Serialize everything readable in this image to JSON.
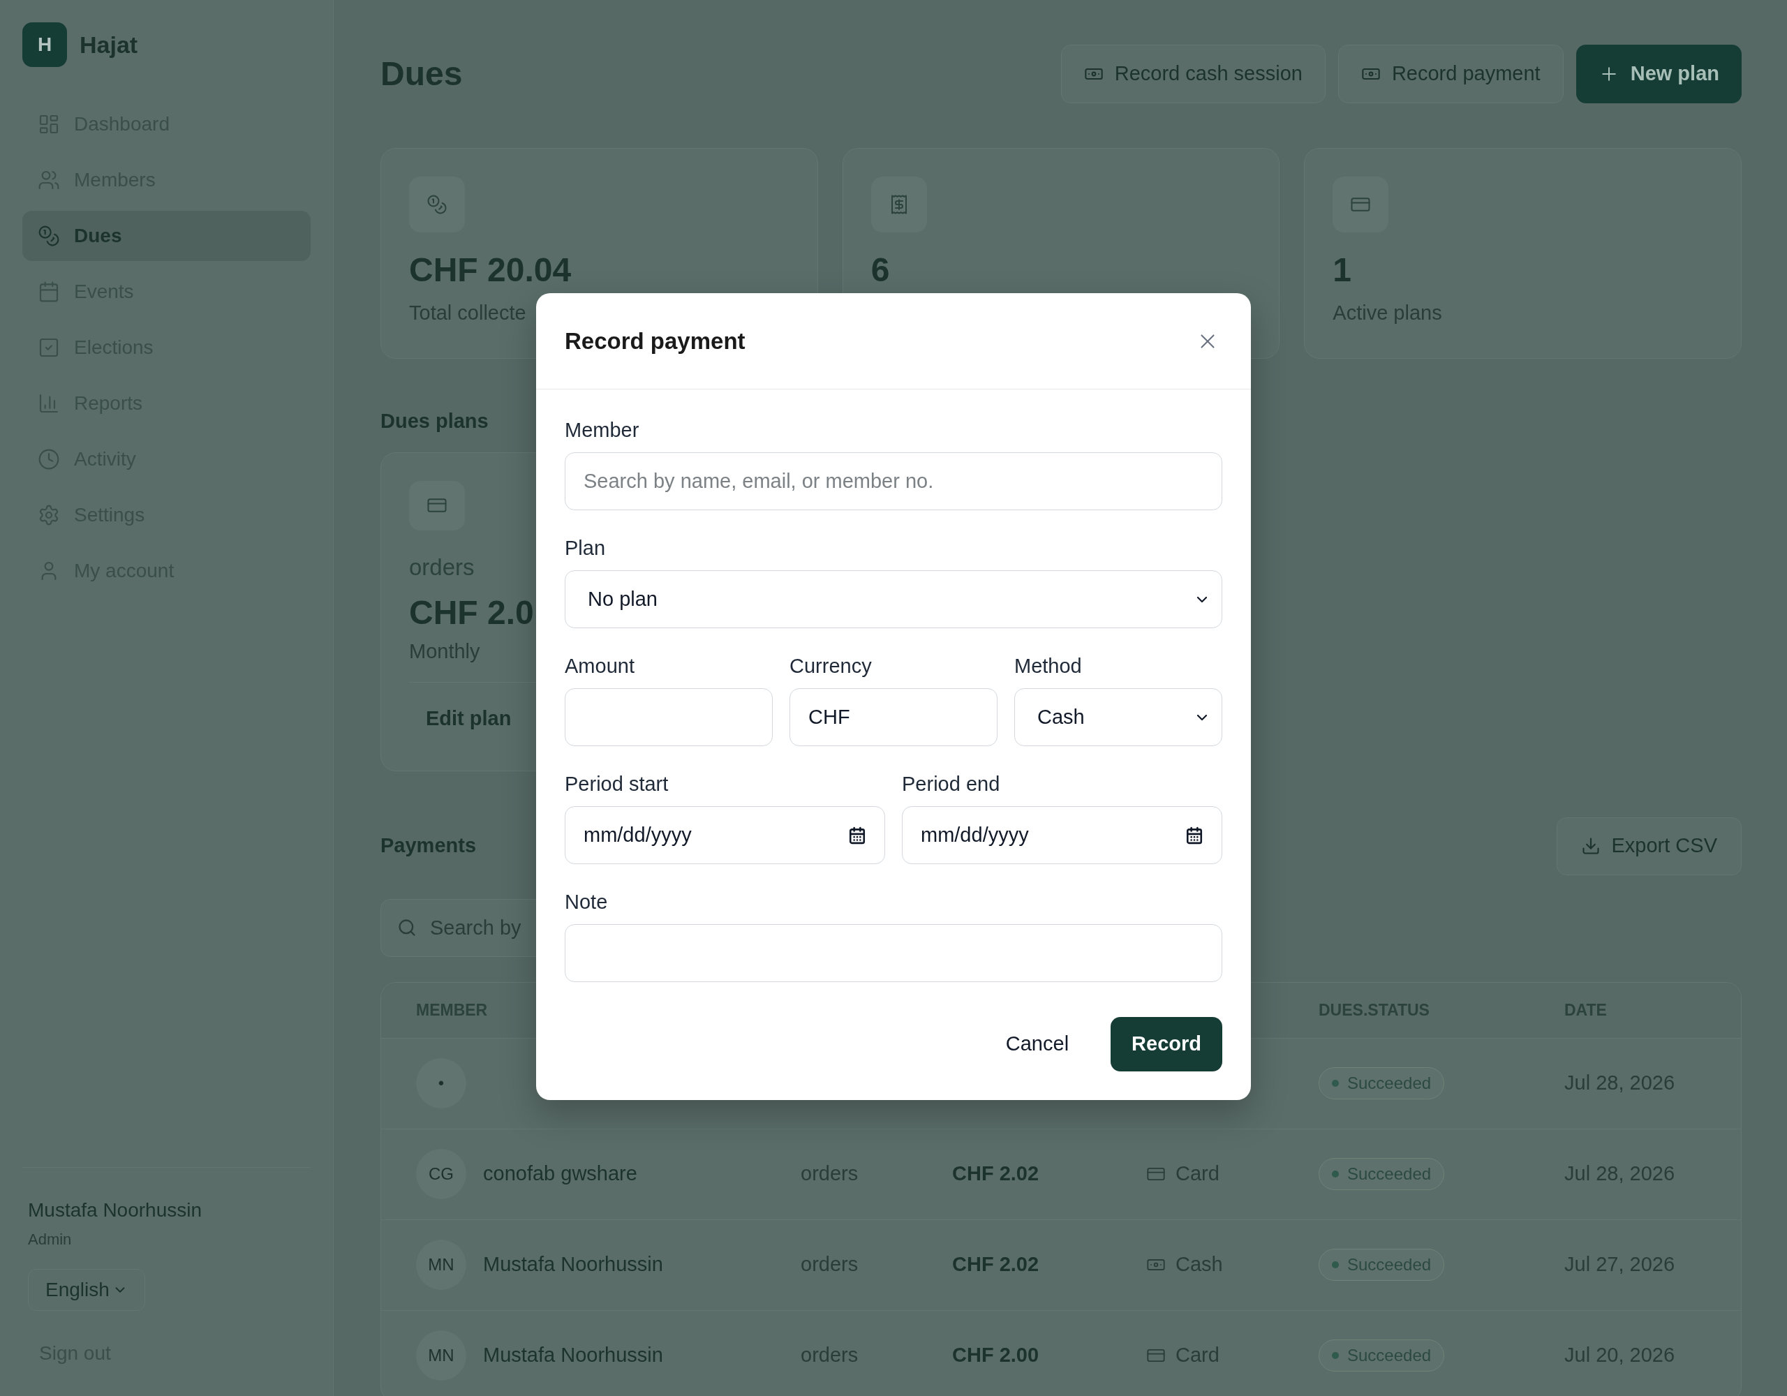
{
  "sidebar": {
    "logo": {
      "letter": "H",
      "name": "Hajat"
    },
    "nav": [
      {
        "label": "Dashboard",
        "selected": false
      },
      {
        "label": "Members",
        "selected": false
      },
      {
        "label": "Dues",
        "selected": true
      },
      {
        "label": "Events",
        "selected": false
      },
      {
        "label": "Elections",
        "selected": false
      },
      {
        "label": "Reports",
        "selected": false
      },
      {
        "label": "Activity",
        "selected": false
      },
      {
        "label": "Settings",
        "selected": false
      },
      {
        "label": "My account",
        "selected": false
      }
    ],
    "user": {
      "name": "Mustafa Noorhussin",
      "role": "Admin"
    },
    "language": "English",
    "sign_out": "Sign out"
  },
  "header": {
    "title": "Dues",
    "actions": [
      {
        "label": "Record cash session",
        "kind": "secondary"
      },
      {
        "label": "Record payment",
        "kind": "secondary"
      },
      {
        "label": "New plan",
        "kind": "primary"
      }
    ]
  },
  "stats": [
    {
      "value": "CHF 20.04",
      "label": "Total collecte"
    },
    {
      "value": "6"
    },
    {
      "value": "1",
      "label": "Active plans"
    }
  ],
  "plans": {
    "title": "Dues plans",
    "items": [
      {
        "name": "orders",
        "amount": "CHF 2.0",
        "interval": "Monthly",
        "action": "Edit plan"
      }
    ]
  },
  "payments": {
    "title": "Payments",
    "export": "Export CSV",
    "search_placeholder": "Search by",
    "columns": [
      {
        "kind": "member",
        "label": "MEMBER"
      },
      {
        "kind": "status",
        "label": "DUES.STATUS"
      },
      {
        "kind": "date",
        "label": "DATE"
      }
    ],
    "rows": [
      {
        "initials": "•",
        "status": "Succeeded",
        "date": "Jul 28, 2026"
      },
      {
        "initials": "CG",
        "name": "conofab gwshare",
        "plan": "orders",
        "amount": "CHF 2.02",
        "method": {
          "label": "Card",
          "kind": "card"
        },
        "status": "Succeeded",
        "date": "Jul 28, 2026"
      },
      {
        "initials": "MN",
        "name": "Mustafa Noorhussin",
        "plan": "orders",
        "amount": "CHF 2.02",
        "method": {
          "label": "Cash",
          "kind": "cash"
        },
        "status": "Succeeded",
        "date": "Jul 27, 2026"
      },
      {
        "initials": "MN",
        "name": "Mustafa Noorhussin",
        "plan": "orders",
        "amount": "CHF 2.00",
        "method": {
          "label": "Card",
          "kind": "card"
        },
        "status": "Succeeded",
        "date": "Jul 20, 2026"
      }
    ]
  },
  "dialog": {
    "title": "Record payment",
    "rows": [
      [
        {
          "kind": "text",
          "label": "Member",
          "placeholder": "Search by name, email, or member no."
        }
      ],
      [
        {
          "kind": "select",
          "label": "Plan",
          "value": "No plan"
        }
      ],
      [
        {
          "kind": "text",
          "label": "Amount"
        },
        {
          "kind": "text",
          "label": "Currency",
          "value": "CHF"
        },
        {
          "kind": "select",
          "label": "Method",
          "value": "Cash"
        }
      ],
      [
        {
          "kind": "date",
          "label": "Period start",
          "value": "mm/dd/yyyy"
        },
        {
          "kind": "date",
          "label": "Period end",
          "value": "mm/dd/yyyy"
        }
      ],
      [
        {
          "kind": "text",
          "label": "Note"
        }
      ]
    ],
    "actions": [
      {
        "label": "Cancel",
        "kind": "ghost"
      },
      {
        "label": "Record",
        "kind": "primary"
      }
    ]
  }
}
